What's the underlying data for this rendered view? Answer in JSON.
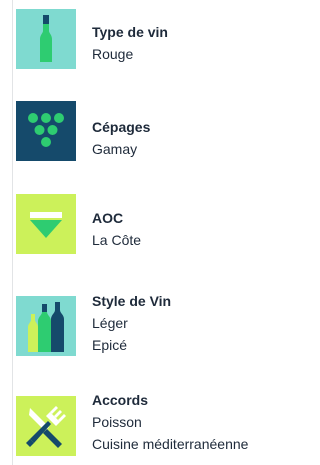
{
  "colors": {
    "teal": "#7fdad0",
    "navy": "#154a6b",
    "lime": "#ccf15a",
    "green": "#2ecc71",
    "text": "#1e2a3a"
  },
  "attributes": [
    {
      "label": "Type de vin",
      "values": [
        "Rouge"
      ],
      "icon": "wine-bottle-icon"
    },
    {
      "label": "Cépages",
      "values": [
        "Gamay"
      ],
      "icon": "grapes-icon"
    },
    {
      "label": "AOC",
      "values": [
        "La Côte"
      ],
      "icon": "wine-glass-icon"
    },
    {
      "label": "Style de Vin",
      "values": [
        "Léger",
        "Epicé"
      ],
      "icon": "bottles-icon"
    },
    {
      "label": "Accords",
      "values": [
        "Poisson",
        "Cuisine méditerranéenne"
      ],
      "icon": "fork-knife-icon"
    }
  ]
}
